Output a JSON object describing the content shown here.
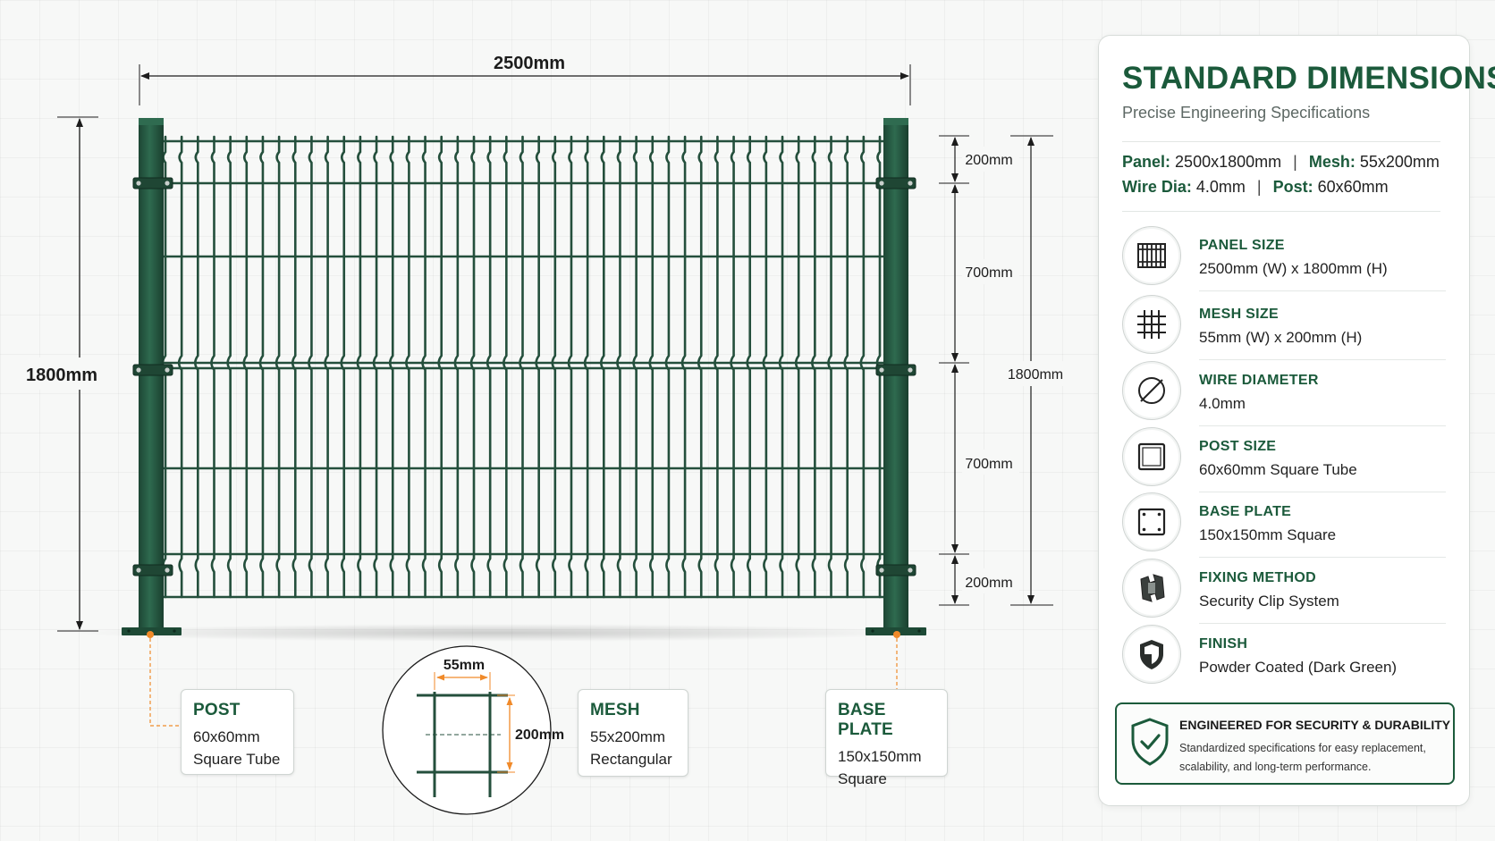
{
  "diagram": {
    "dimensions": {
      "width": "2500mm",
      "height_left": "1800mm",
      "height_right": "1800mm",
      "segments": [
        "200mm",
        "700mm",
        "700mm",
        "200mm"
      ]
    },
    "mesh_detail": {
      "width": "55mm",
      "height": "200mm"
    },
    "callouts": {
      "post": {
        "title": "POST",
        "lines": [
          "60x60mm",
          "Square Tube"
        ]
      },
      "mesh": {
        "title": "MESH",
        "lines": [
          "55x200mm",
          "Rectangular"
        ]
      },
      "base_plate": {
        "title": "BASE PLATE",
        "lines": [
          "150x150mm",
          "Square"
        ]
      }
    }
  },
  "panel": {
    "heading": "STANDARD DIMENSIONS",
    "subtitle": "Precise Engineering Specifications",
    "summary": {
      "row1": [
        {
          "key": "Panel:",
          "value": "2500x1800mm"
        },
        {
          "key": "Mesh:",
          "value": "55x200mm"
        }
      ],
      "row2": [
        {
          "key": "Wire Dia:",
          "value": "4.0mm"
        },
        {
          "key": "Post:",
          "value": "60x60mm"
        }
      ],
      "separator": "|"
    },
    "specs": [
      {
        "label": "PANEL SIZE",
        "value": "2500mm (W) x 1800mm (H)",
        "icon": "panel-grid-icon"
      },
      {
        "label": "MESH SIZE",
        "value": "55mm (W) x 200mm (H)",
        "icon": "mesh-grid-icon"
      },
      {
        "label": "WIRE DIAMETER",
        "value": "4.0mm",
        "icon": "diameter-icon"
      },
      {
        "label": "POST SIZE",
        "value": "60x60mm Square Tube",
        "icon": "square-tube-icon"
      },
      {
        "label": "BASE PLATE",
        "value": "150x150mm Square",
        "icon": "base-plate-icon"
      },
      {
        "label": "FIXING METHOD",
        "value": "Security Clip System",
        "icon": "clip-icon"
      },
      {
        "label": "FINISH",
        "value": "Powder Coated (Dark Green)",
        "icon": "shield-icon"
      }
    ],
    "banner": {
      "title": "ENGINEERED FOR SECURITY & DURABILITY",
      "text": "Standardized specifications for easy replacement, scalability, and long-term performance.",
      "icon": "shield-check-icon"
    }
  },
  "colors": {
    "accent": "#1b5a3b",
    "fence": "#244f3c",
    "orange": "#f08a2a"
  }
}
